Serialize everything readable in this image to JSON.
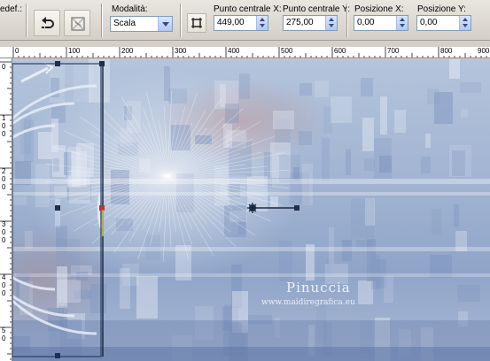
{
  "toolbar": {
    "preset_label": "edef.:",
    "mode": {
      "label": "Modalità:",
      "value": "Scala"
    },
    "center_x": {
      "label": "Punto centrale X:",
      "value": "449,00"
    },
    "center_y": {
      "label": "Punto centrale Y:",
      "value": "275,00"
    },
    "pos_x": {
      "label": "Posizione X:",
      "value": "0,00"
    },
    "pos_y": {
      "label": "Posizione Y:",
      "value": "0,00"
    }
  },
  "ruler_h": {
    "labels": [
      "0",
      "100",
      "200",
      "300",
      "400",
      "500",
      "600",
      "700",
      "800",
      "900"
    ]
  },
  "ruler_v": {
    "fragments": [
      "0",
      "1",
      "0",
      "0",
      "2",
      "0",
      "0",
      "3",
      "0",
      "0",
      "4",
      "0",
      "0",
      "5",
      "0"
    ]
  },
  "watermark": {
    "title": "Pinuccia",
    "url": "www.maidiregrafica.eu"
  }
}
